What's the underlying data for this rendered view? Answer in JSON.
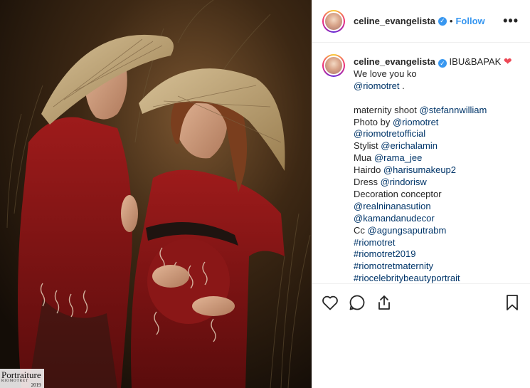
{
  "header": {
    "username": "celine_evangelista",
    "separator": "•",
    "follow_label": "Follow",
    "more_label": "•••"
  },
  "photo": {
    "watermark_title": "Portraiture",
    "watermark_sub": "RIOMOTRET",
    "watermark_year": "2019"
  },
  "caption": {
    "username": "celine_evangelista",
    "title": "IBU&BAPAK",
    "lines": [
      {
        "text": "We love you ko",
        "link": false
      },
      {
        "text": "@riomotret",
        "link": true,
        "suffix": " ."
      },
      {
        "text": "",
        "link": false
      },
      {
        "text": "maternity shoot ",
        "link": false,
        "mention": "@stefannwilliam"
      },
      {
        "text": "Photo by ",
        "link": false,
        "mention": "@riomotret"
      },
      {
        "text": "@riomotretofficial",
        "link": true
      },
      {
        "text": "Stylist ",
        "link": false,
        "mention": "@erichalamin"
      },
      {
        "text": "Mua ",
        "link": false,
        "mention": "@rama_jee"
      },
      {
        "text": "Hairdo ",
        "link": false,
        "mention": "@harisumakeup2"
      },
      {
        "text": "Dress ",
        "link": false,
        "mention": "@rindorisw"
      },
      {
        "text": "Decoration conceptor",
        "link": false
      },
      {
        "text": "@realninanasution",
        "link": true
      },
      {
        "text": "@kamandanudecor",
        "link": true
      },
      {
        "text": "Cc ",
        "link": false,
        "mention": "@agungsaputrabm"
      },
      {
        "text": "#riomotret",
        "link": true
      },
      {
        "text": "#riomotret2019",
        "link": true
      },
      {
        "text": "#riomotretmaternity",
        "link": true
      },
      {
        "text": "#riocelebritybeautyportrait",
        "link": true
      }
    ]
  },
  "actions": {
    "icons": [
      "heart-outline-icon",
      "comment-icon",
      "share-icon",
      "bookmark-icon"
    ]
  },
  "colors": {
    "link": "#003569",
    "follow": "#3897f0",
    "verified": "#3897f0",
    "heart": "#ed4956"
  }
}
